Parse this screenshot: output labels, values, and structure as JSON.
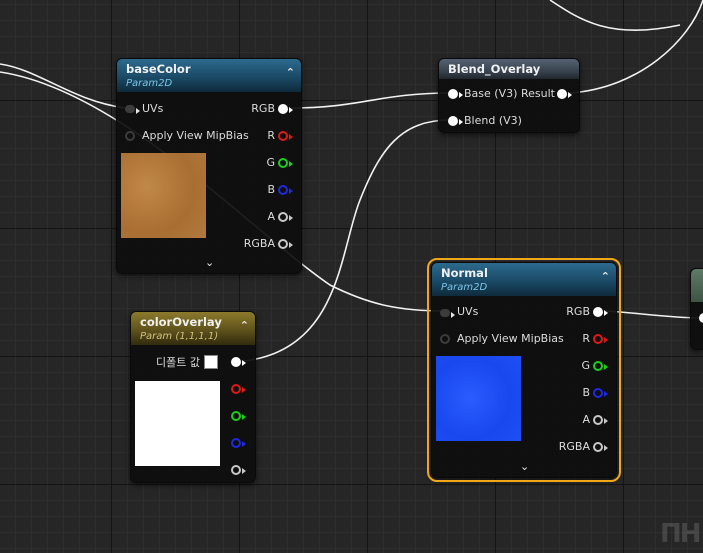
{
  "colors": {
    "wire": "#f2f2f2",
    "selection_outline": "#f0a818",
    "header_blue": "#1a4a66",
    "header_gold": "#5e521c",
    "header_slate": "#394350",
    "pin_red": "#e01818",
    "pin_green": "#18d018",
    "pin_blue": "#1f2adf",
    "swatch_base": "#b07a3c",
    "swatch_overlay": "#ffffff",
    "swatch_normal": "#1b4ef5"
  },
  "nodes": {
    "baseColor": {
      "title": "baseColor",
      "subtitle": "Param2D",
      "collapse_icon": "chevron-up-icon",
      "inputs": {
        "uvs": "UVs",
        "mipbias": "Apply View MipBias"
      },
      "outputs": {
        "rgb": "RGB",
        "r": "R",
        "g": "G",
        "b": "B",
        "a": "A",
        "rgba": "RGBA"
      },
      "expand_icon": "chevron-down-icon"
    },
    "blendOverlay": {
      "title": "Blend_Overlay",
      "inputs": {
        "base": "Base (V3)",
        "blend": "Blend (V3)"
      },
      "outputs": {
        "result": "Result"
      }
    },
    "colorOverlay": {
      "title": "colorOverlay",
      "subtitle": "Param (1,1,1,1)",
      "collapse_icon": "chevron-up-icon",
      "default_value_label": "디폴트 값"
    },
    "normal": {
      "title": "Normal",
      "subtitle": "Param2D",
      "collapse_icon": "chevron-up-icon",
      "inputs": {
        "uvs": "UVs",
        "mipbias": "Apply View MipBias"
      },
      "outputs": {
        "rgb": "RGB",
        "r": "R",
        "g": "G",
        "b": "B",
        "a": "A",
        "rgba": "RGBA"
      },
      "expand_icon": "chevron-down-icon"
    }
  },
  "watermark": "ΠH"
}
